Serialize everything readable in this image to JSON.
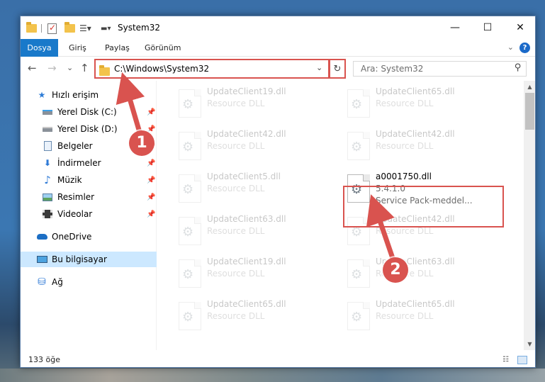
{
  "window": {
    "title": "System32",
    "controls": {
      "minimize": "—",
      "maximize": "☐",
      "close": "✕"
    }
  },
  "ribbon": {
    "tabs": [
      "Dosya",
      "Giriş",
      "Paylaş",
      "Görünüm"
    ],
    "help": "?"
  },
  "nav": {
    "back": "←",
    "forward": "→",
    "recent": "⌄",
    "up": "↑",
    "address": "C:\\Windows\\System32",
    "dropdown": "⌄",
    "refresh": "↻",
    "search_placeholder": "Ara: System32"
  },
  "sidebar": {
    "items": [
      {
        "label": "Hızlı erişim",
        "icon": "star-icon",
        "pinned": false
      },
      {
        "label": "Yerel Disk (C:)",
        "icon": "drive-icon",
        "pinned": true
      },
      {
        "label": "Yerel Disk (D:)",
        "icon": "drive-icon",
        "pinned": true
      },
      {
        "label": "Belgeler",
        "icon": "documents-icon",
        "pinned": true
      },
      {
        "label": "İndirmeler",
        "icon": "download-icon",
        "pinned": true
      },
      {
        "label": "Müzik",
        "icon": "music-icon",
        "pinned": true
      },
      {
        "label": "Resimler",
        "icon": "pictures-icon",
        "pinned": true
      },
      {
        "label": "Videolar",
        "icon": "videos-icon",
        "pinned": true
      },
      {
        "label": "OneDrive",
        "icon": "cloud-icon",
        "pinned": false
      },
      {
        "label": "Bu bilgisayar",
        "icon": "computer-icon",
        "pinned": false,
        "selected": true
      },
      {
        "label": "Ağ",
        "icon": "network-icon",
        "pinned": false
      }
    ]
  },
  "files": {
    "left": [
      {
        "name": "UpdateClient19.dll",
        "type": "Resource DLL"
      },
      {
        "name": "UpdateClient42.dll",
        "type": "Resource DLL"
      },
      {
        "name": "UpdateClient5.dll",
        "type": "Resource DLL"
      },
      {
        "name": "UpdateClient63.dll",
        "type": "Resource DLL"
      },
      {
        "name": "UpdateClient19.dll",
        "type": "Resource DLL"
      },
      {
        "name": "UpdateClient65.dll",
        "type": "Resource DLL"
      }
    ],
    "right": [
      {
        "name": "UpdateClient65.dll",
        "type": "Resource DLL"
      },
      {
        "name": "UpdateClient42.dll",
        "type": "Resource DLL"
      },
      {
        "name": "a0001750.dll",
        "type": "5.4.1.0",
        "extra": "Service Pack-meddel...",
        "highlighted": true
      },
      {
        "name": "UpdateClient42.dll",
        "type": "Resource DLL"
      },
      {
        "name": "UpdateClient63.dll",
        "type": "Resource DLL"
      },
      {
        "name": "UpdateClient65.dll",
        "type": "Resource DLL"
      }
    ]
  },
  "status": {
    "count": "133 öğe"
  },
  "callouts": [
    "1",
    "2"
  ],
  "colors": {
    "accent": "#1979ca",
    "highlight": "#d9534f",
    "selected": "#cce8ff"
  }
}
